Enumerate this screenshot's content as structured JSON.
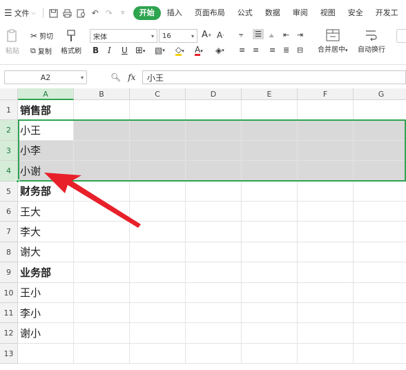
{
  "menubar": {
    "file_label": "文件",
    "tabs": [
      {
        "label": "开始",
        "active": true
      },
      {
        "label": "插入"
      },
      {
        "label": "页面布局"
      },
      {
        "label": "公式"
      },
      {
        "label": "数据"
      },
      {
        "label": "审阅"
      },
      {
        "label": "视图"
      },
      {
        "label": "安全"
      },
      {
        "label": "开发工"
      }
    ]
  },
  "ribbon": {
    "paste_label": "粘贴",
    "cut_label": "剪切",
    "copy_label": "复制",
    "format_painter_label": "格式刷",
    "font_name": "宋体",
    "font_size": "16",
    "merge_center_label": "合并居中",
    "wrap_text_label": "自动换行"
  },
  "formula_bar": {
    "name_box": "A2",
    "fx_label": "fx",
    "value": "小王"
  },
  "sheet": {
    "columns": [
      "A",
      "B",
      "C",
      "D",
      "E",
      "F",
      "G"
    ],
    "rows": [
      "1",
      "2",
      "3",
      "4",
      "5",
      "6",
      "7",
      "8",
      "9",
      "10",
      "11",
      "12",
      "13"
    ],
    "cells": [
      "销售部",
      "小王",
      "小李",
      "小谢",
      "财务部",
      "王大",
      "李大",
      "谢大",
      "业务部",
      "王小",
      "李小",
      "谢小",
      ""
    ],
    "selected_rows": [
      2,
      3,
      4
    ],
    "active_cell": "A2"
  },
  "colors": {
    "accent": "#2ea44f",
    "selection_bg": "#d9d9d9",
    "arrow": "#e8202a"
  }
}
